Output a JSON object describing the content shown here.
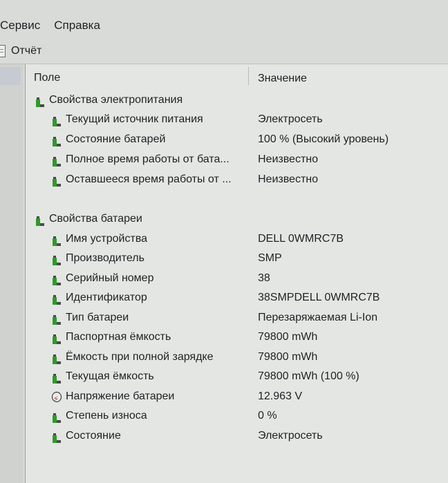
{
  "menu": {
    "items": [
      "Сервис",
      "Справка"
    ]
  },
  "toolbar": {
    "report_label": "Отчёт"
  },
  "table": {
    "col_field": "Поле",
    "col_value": "Значение",
    "groups": [
      {
        "title": "Свойства электропитания",
        "rows": [
          {
            "field": "Текущий источник питания",
            "value": "Электросеть"
          },
          {
            "field": "Состояние батарей",
            "value": "100 % (Высокий уровень)"
          },
          {
            "field": "Полное время работы от бата...",
            "value": "Неизвестно"
          },
          {
            "field": "Оставшееся время работы от ...",
            "value": "Неизвестно"
          }
        ]
      },
      {
        "title": "Свойства батареи",
        "rows": [
          {
            "field": "Имя устройства",
            "value": "DELL 0WMRC7B"
          },
          {
            "field": "Производитель",
            "value": "SMP"
          },
          {
            "field": "Серийный номер",
            "value": "38"
          },
          {
            "field": "Идентификатор",
            "value": "38SMPDELL 0WMRC7B"
          },
          {
            "field": "Тип батареи",
            "value": "Перезаряжаемая Li-Ion"
          },
          {
            "field": "Паспортная ёмкость",
            "value": "79800 mWh"
          },
          {
            "field": "Ёмкость при полной зарядке",
            "value": "79800 mWh"
          },
          {
            "field": "Текущая ёмкость",
            "value": "79800 mWh  (100 %)"
          },
          {
            "field": "Напряжение батареи",
            "value": "12.963 V"
          },
          {
            "field": "Степень износа",
            "value": "0 %"
          },
          {
            "field": "Состояние",
            "value": "Электросеть"
          }
        ]
      }
    ]
  },
  "icons": {
    "row_icon": "green-battery-icon",
    "voltage_icon": "voltage-lightning-icon"
  },
  "colors": {
    "battery_green": "#2e9a2a",
    "battery_cap": "#4a4a4a",
    "lightning": "#c2351f"
  }
}
